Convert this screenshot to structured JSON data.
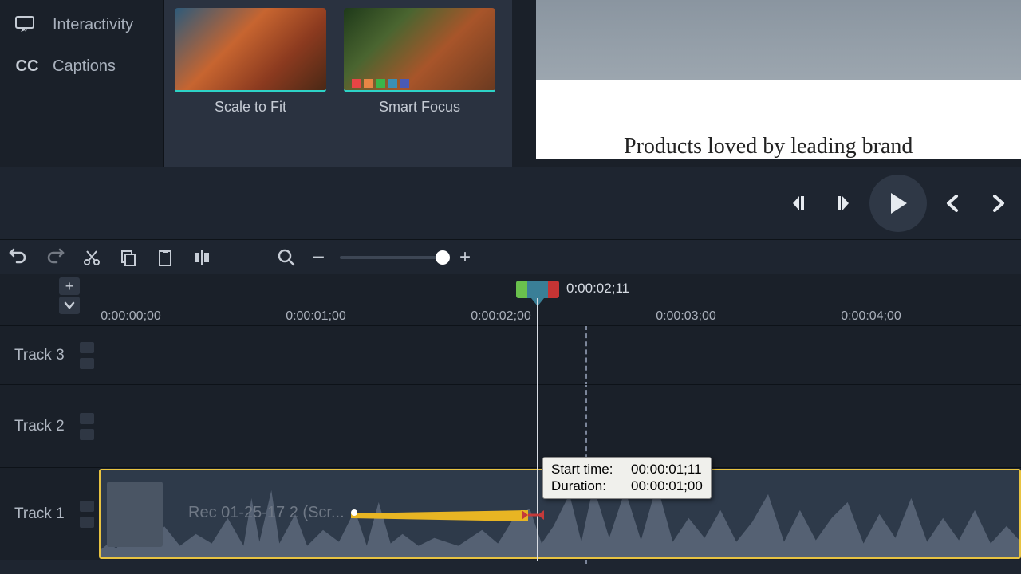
{
  "sidebar": {
    "interactivity_label": "Interactivity",
    "captions_label": "Captions",
    "cc_text": "CC"
  },
  "media": {
    "thumbs": [
      {
        "label": "Scale to Fit"
      },
      {
        "label": "Smart Focus"
      }
    ]
  },
  "preview": {
    "text": "Products loved by leading brand"
  },
  "playhead": {
    "time": "0:00:02;11"
  },
  "ruler": {
    "ticks": [
      "0:00:00;00",
      "0:00:01;00",
      "0:00:02;00",
      "0:00:03;00",
      "0:00:04;00"
    ]
  },
  "tracks": {
    "t3": "Track 3",
    "t2": "Track 2",
    "t1": "Track 1"
  },
  "clip": {
    "label": "Rec 01-25-17 2 (Scr..."
  },
  "tooltip": {
    "start_key": "Start time:",
    "start_val": "00:00:01;11",
    "dur_key": "Duration:",
    "dur_val": "00:00:01;00"
  },
  "zoom": {
    "minus": "−",
    "plus": "+"
  }
}
